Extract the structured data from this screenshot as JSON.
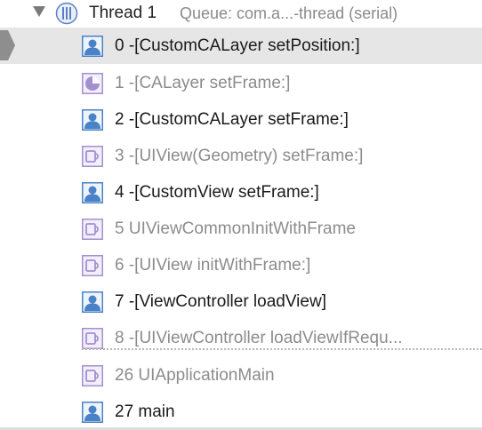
{
  "thread": {
    "title": "Thread 1",
    "queue": "Queue: com.a...-thread (serial)"
  },
  "frames": [
    {
      "label": "0 -[CustomCALayer setPosition:]",
      "kind": "user",
      "icon": "user-code-icon",
      "selected": true
    },
    {
      "label": "1 -[CALayer setFrame:]",
      "kind": "system",
      "icon": "quartzcore-icon"
    },
    {
      "label": "2 -[CustomCALayer setFrame:]",
      "kind": "user",
      "icon": "user-code-icon"
    },
    {
      "label": "3 -[UIView(Geometry) setFrame:]",
      "kind": "system",
      "icon": "uikit-mug-icon"
    },
    {
      "label": "4 -[CustomView setFrame:]",
      "kind": "user",
      "icon": "user-code-icon"
    },
    {
      "label": "5 UIViewCommonInitWithFrame",
      "kind": "system",
      "icon": "uikit-mug-icon"
    },
    {
      "label": "6 -[UIView initWithFrame:]",
      "kind": "system",
      "icon": "uikit-mug-icon"
    },
    {
      "label": "7 -[ViewController loadView]",
      "kind": "user",
      "icon": "user-code-icon"
    },
    {
      "label": "8 -[UIViewController loadViewIfRequ...",
      "kind": "system",
      "icon": "uikit-mug-icon"
    },
    {
      "label": "26 UIApplicationMain",
      "kind": "system",
      "icon": "uikit-mug-icon"
    },
    {
      "label": "27 main",
      "kind": "user",
      "icon": "user-code-icon"
    }
  ],
  "colors": {
    "user_icon": "#4a90d9",
    "system_icon": "#b39ddb",
    "selection": "#e6e6e6",
    "user_text": "#1a1a1a",
    "system_text": "#8c8c8c"
  }
}
